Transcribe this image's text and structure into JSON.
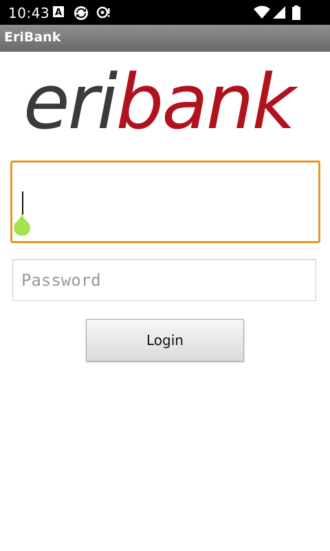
{
  "status_bar": {
    "time": "10:43",
    "left_icons": [
      "a-icon",
      "sync-icon",
      "record-icon"
    ],
    "right_icons": [
      "wifi-icon",
      "signal-icon",
      "battery-icon"
    ]
  },
  "app": {
    "title": "EriBank"
  },
  "logo": {
    "part1": "eri",
    "part2": "bank",
    "colors": {
      "part1": "#3a3a3a",
      "part2": "#b0121e"
    }
  },
  "form": {
    "username": {
      "value": "",
      "placeholder": "",
      "focused": true,
      "focus_color": "#e8942a"
    },
    "password": {
      "value": "",
      "placeholder": "Password"
    },
    "login_label": "Login"
  },
  "colors": {
    "handle": "#a4e34a",
    "title_bar": "#7d7d7d"
  }
}
